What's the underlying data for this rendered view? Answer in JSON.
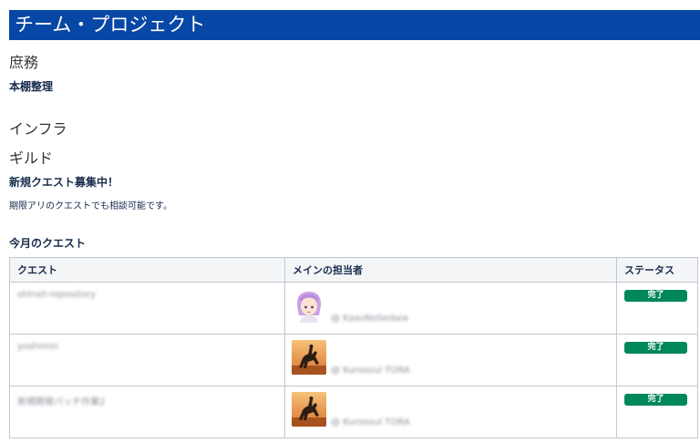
{
  "page": {
    "title": "チーム・プロジェクト"
  },
  "sections": {
    "general": "庶務",
    "bookshelf": "本棚整理",
    "infra": "インフラ",
    "guild": "ギルド",
    "recruit_heading": "新規クエスト募集中！",
    "recruit_text": "期限アリのクエストでも相談可能です。",
    "monthly_heading": "今月のクエスト"
  },
  "table": {
    "headers": {
      "quest": "クエスト",
      "assignee": "メインの担当者",
      "status": "ステータス"
    },
    "rows": [
      {
        "quest": "shtnet-repository",
        "avatar_icon": "anime-girl-avatar-icon",
        "assignee": "@ KasuNoSedaia",
        "status": "完了"
      },
      {
        "quest": "yoshimin",
        "avatar_icon": "horse-rider-avatar-icon",
        "assignee": "@ Kurosoul TORA",
        "status": "完了"
      },
      {
        "quest": "新規開発パッチ作業2",
        "avatar_icon": "horse-rider-avatar-icon",
        "assignee": "@ Kurosoul TORA",
        "status": "完了"
      }
    ]
  },
  "colors": {
    "title_bar": "#0747a6",
    "status_done": "#00875a",
    "table_header_bg": "#f4f5f7"
  }
}
